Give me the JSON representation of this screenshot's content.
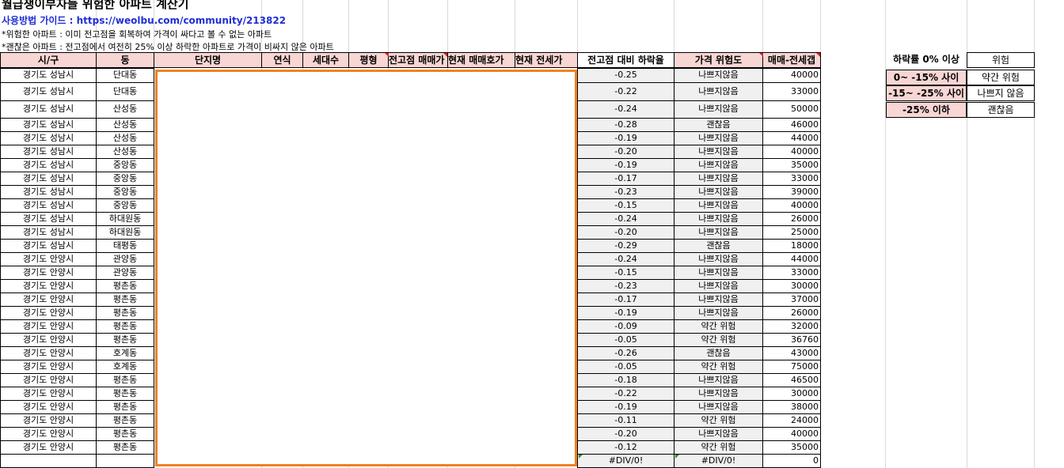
{
  "title": "월급쟁이부자들 위험한 아파트 계산기",
  "guide": "사용방법 가이드 : https://weolbu.com/community/213822",
  "note1": "*위험한 아파트 : 이미 전고점을 회복하여 가격이 싸다고 볼 수 없는 아파트",
  "note2": "*괜찮은 아파트 : 전고점에서 여전히 25% 이상 하락한 아파트로 가격이 비싸지 않은 아파트",
  "headers": {
    "city": "시/구",
    "dong": "동",
    "complex": "단지명",
    "year": "연식",
    "households": "세대수",
    "pyeong": "평형",
    "peak_price": "전고점 매매가",
    "current_ask": "현재 매매호가",
    "current_jeonse": "현재 전세가",
    "drop_rate": "전고점 대비 하락율",
    "risk": "가격 위험도",
    "gap": "매매-전세갭"
  },
  "rows": [
    {
      "city": "경기도 성남시",
      "dong": "단대동",
      "rate": "-0.25",
      "risk": "나쁘지않음",
      "gap": "40000"
    },
    {
      "city": "경기도 성남시",
      "dong": "단대동",
      "rate": "-0.22",
      "risk": "나쁘지않음",
      "gap": "33000"
    },
    {
      "city": "경기도 성남시",
      "dong": "산성동",
      "rate": "-0.24",
      "risk": "나쁘지않음",
      "gap": "50000"
    },
    {
      "city": "경기도 성남시",
      "dong": "산성동",
      "rate": "-0.28",
      "risk": "괜찮음",
      "gap": "46000"
    },
    {
      "city": "경기도 성남시",
      "dong": "산성동",
      "rate": "-0.19",
      "risk": "나쁘지않음",
      "gap": "44000"
    },
    {
      "city": "경기도 성남시",
      "dong": "산성동",
      "rate": "-0.20",
      "risk": "나쁘지않음",
      "gap": "40000"
    },
    {
      "city": "경기도 성남시",
      "dong": "중앙동",
      "rate": "-0.19",
      "risk": "나쁘지않음",
      "gap": "35000"
    },
    {
      "city": "경기도 성남시",
      "dong": "중앙동",
      "rate": "-0.17",
      "risk": "나쁘지않음",
      "gap": "33000"
    },
    {
      "city": "경기도 성남시",
      "dong": "중앙동",
      "rate": "-0.23",
      "risk": "나쁘지않음",
      "gap": "39000"
    },
    {
      "city": "경기도 성남시",
      "dong": "중앙동",
      "rate": "-0.15",
      "risk": "나쁘지않음",
      "gap": "40000"
    },
    {
      "city": "경기도 성남시",
      "dong": "하대원동",
      "rate": "-0.24",
      "risk": "나쁘지않음",
      "gap": "26000"
    },
    {
      "city": "경기도 성남시",
      "dong": "하대원동",
      "rate": "-0.20",
      "risk": "나쁘지않음",
      "gap": "25000"
    },
    {
      "city": "경기도 성남시",
      "dong": "태평동",
      "rate": "-0.29",
      "risk": "괜찮음",
      "gap": "18000"
    },
    {
      "city": "경기도 안양시",
      "dong": "관양동",
      "rate": "-0.24",
      "risk": "나쁘지않음",
      "gap": "44000"
    },
    {
      "city": "경기도 안양시",
      "dong": "관양동",
      "rate": "-0.15",
      "risk": "나쁘지않음",
      "gap": "33000"
    },
    {
      "city": "경기도 안양시",
      "dong": "평촌동",
      "rate": "-0.23",
      "risk": "나쁘지않음",
      "gap": "30000"
    },
    {
      "city": "경기도 안양시",
      "dong": "평촌동",
      "rate": "-0.17",
      "risk": "나쁘지않음",
      "gap": "37000"
    },
    {
      "city": "경기도 안양시",
      "dong": "평촌동",
      "rate": "-0.19",
      "risk": "나쁘지않음",
      "gap": "26000"
    },
    {
      "city": "경기도 안양시",
      "dong": "평촌동",
      "rate": "-0.09",
      "risk": "약간 위험",
      "gap": "32000"
    },
    {
      "city": "경기도 안양시",
      "dong": "평촌동",
      "rate": "-0.05",
      "risk": "약간 위험",
      "gap": "36760"
    },
    {
      "city": "경기도 안양시",
      "dong": "호계동",
      "rate": "-0.26",
      "risk": "괜찮음",
      "gap": "43000"
    },
    {
      "city": "경기도 안양시",
      "dong": "호계동",
      "rate": "-0.05",
      "risk": "약간 위험",
      "gap": "75000"
    },
    {
      "city": "경기도 안양시",
      "dong": "평촌동",
      "rate": "-0.18",
      "risk": "나쁘지않음",
      "gap": "46500"
    },
    {
      "city": "경기도 안양시",
      "dong": "평촌동",
      "rate": "-0.22",
      "risk": "나쁘지않음",
      "gap": "30000"
    },
    {
      "city": "경기도 안양시",
      "dong": "평촌동",
      "rate": "-0.19",
      "risk": "나쁘지않음",
      "gap": "38000"
    },
    {
      "city": "경기도 안양시",
      "dong": "평촌동",
      "rate": "-0.11",
      "risk": "약간 위험",
      "gap": "24000"
    },
    {
      "city": "경기도 안양시",
      "dong": "평촌동",
      "rate": "-0.20",
      "risk": "나쁘지않음",
      "gap": "40000"
    },
    {
      "city": "경기도 안양시",
      "dong": "평촌동",
      "rate": "-0.12",
      "risk": "약간 위험",
      "gap": "35000"
    },
    {
      "city": "",
      "dong": "",
      "rate": "#DIV/0!",
      "risk": "#DIV/0!",
      "gap": "0"
    }
  ],
  "legend": [
    {
      "range": "하락률 0% 이상",
      "label": "위험"
    },
    {
      "range": "0~ -15% 사이",
      "label": "약간 위험"
    },
    {
      "range": "-15~ -25% 사이",
      "label": "나쁘지 않음"
    },
    {
      "range": "-25% 이하",
      "label": "괜찮음"
    }
  ]
}
